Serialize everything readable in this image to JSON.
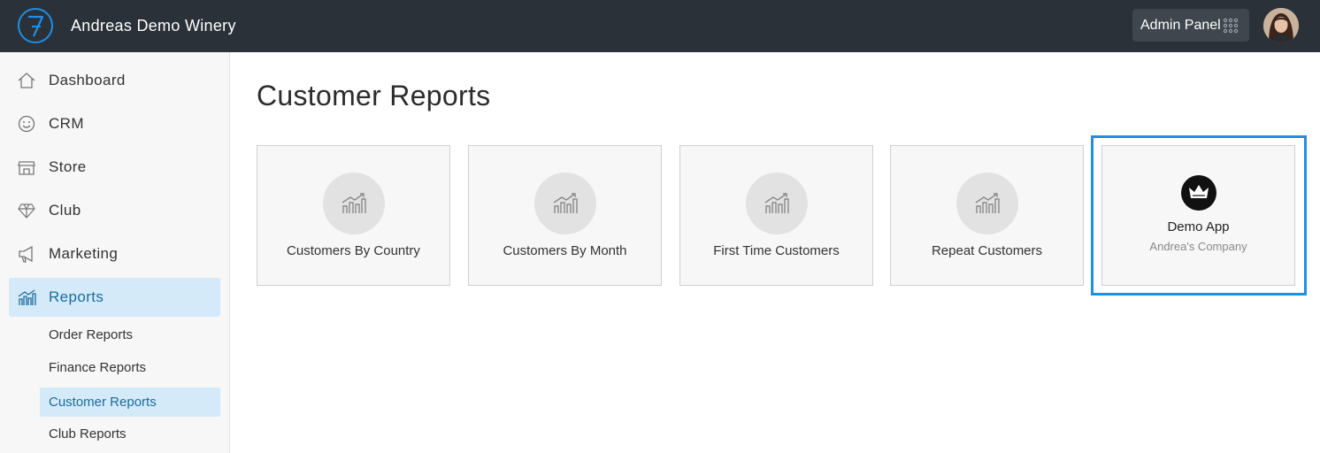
{
  "header": {
    "app_title": "Andreas Demo Winery",
    "admin_panel_label": "Admin Panel"
  },
  "sidebar": {
    "items": [
      {
        "label": "Dashboard",
        "icon": "home-icon"
      },
      {
        "label": "CRM",
        "icon": "smiley-icon"
      },
      {
        "label": "Store",
        "icon": "storefront-icon"
      },
      {
        "label": "Club",
        "icon": "diamond-icon"
      },
      {
        "label": "Marketing",
        "icon": "megaphone-icon"
      },
      {
        "label": "Reports",
        "icon": "bar-chart-icon",
        "active": true
      }
    ],
    "sub_items": [
      {
        "label": "Order Reports"
      },
      {
        "label": "Finance Reports"
      },
      {
        "label": "Customer Reports",
        "active": true
      },
      {
        "label": "Club Reports"
      }
    ]
  },
  "main": {
    "page_title": "Customer Reports",
    "cards": [
      {
        "label": "Customers By Country",
        "icon": "chart-growth-icon"
      },
      {
        "label": "Customers By Month",
        "icon": "chart-growth-icon"
      },
      {
        "label": "First Time Customers",
        "icon": "chart-growth-icon"
      },
      {
        "label": "Repeat Customers",
        "icon": "chart-growth-icon"
      }
    ],
    "app_card": {
      "name": "Demo App",
      "company": "Andrea's Company",
      "icon": "crown-icon"
    }
  },
  "colors": {
    "topbar": "#2a3138",
    "accent": "#1e8fe6",
    "active_bg": "#d5eaf8",
    "active_text": "#1a6d9c"
  }
}
